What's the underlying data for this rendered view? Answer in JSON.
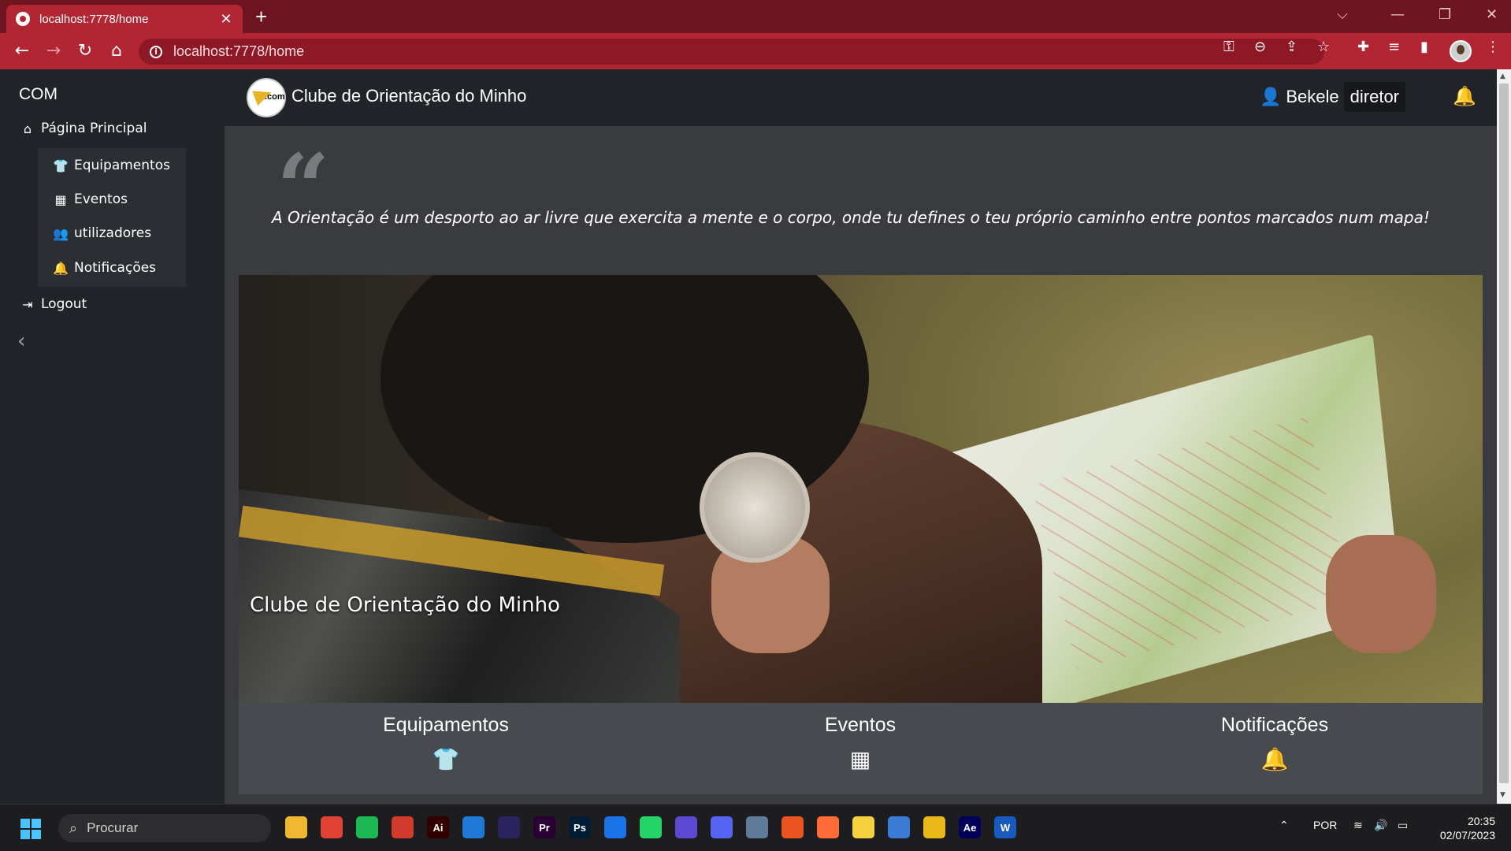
{
  "browser": {
    "tab_title": "localhost:7778/home",
    "tab_close": "✕",
    "new_tab": "+",
    "url": "localhost:7778/home",
    "controls": {
      "dropdown": "⌵",
      "minimize": "—",
      "restore": "❐",
      "close": "✕"
    }
  },
  "sidebar": {
    "brand": "COM",
    "home": {
      "label": "Página Principal",
      "icon": "home-icon"
    },
    "submenu": [
      {
        "label": "Equipamentos",
        "icon": "tshirt-icon"
      },
      {
        "label": "Eventos",
        "icon": "calendar-icon"
      },
      {
        "label": "utilizadores",
        "icon": "users-icon"
      },
      {
        "label": "Notificações",
        "icon": "bell-icon"
      }
    ],
    "logout": {
      "label": "Logout",
      "icon": "logout-icon"
    },
    "collapse_icon": "chevron-left-icon"
  },
  "header": {
    "logo_text": ".com",
    "site_title": "Clube de Orientação do Minho",
    "user_name": "Bekele",
    "user_role": "diretor"
  },
  "main": {
    "quote": "A Orientação é um desporto ao ar livre que exercita a mente e o corpo, onde tu defines o teu próprio caminho entre pontos marcados num mapa!",
    "hero_caption": "Clube de Orientação do Minho",
    "cards": [
      {
        "title": "Equipamentos",
        "icon": "tshirt-icon"
      },
      {
        "title": "Eventos",
        "icon": "calendar-icon"
      },
      {
        "title": "Notificações",
        "icon": "bell-icon"
      }
    ]
  },
  "taskbar": {
    "search_placeholder": "Procurar",
    "language": "POR",
    "time": "20:35",
    "date": "02/07/2023",
    "apps": [
      {
        "name": "file-explorer",
        "label": "",
        "color": "#f2b731"
      },
      {
        "name": "chrome",
        "label": "",
        "color": "#e04236"
      },
      {
        "name": "spotify",
        "label": "",
        "color": "#1db954"
      },
      {
        "name": "app-red-yellow",
        "label": "",
        "color": "#d23a2b"
      },
      {
        "name": "illustrator",
        "label": "Ai",
        "color": "#330000"
      },
      {
        "name": "vscode",
        "label": "",
        "color": "#1e7ad6"
      },
      {
        "name": "dark-app",
        "label": "",
        "color": "#2b2360"
      },
      {
        "name": "premiere",
        "label": "Pr",
        "color": "#2a0034"
      },
      {
        "name": "photoshop",
        "label": "Ps",
        "color": "#001d34"
      },
      {
        "name": "mail",
        "label": "",
        "color": "#1a73e8"
      },
      {
        "name": "whatsapp",
        "label": "",
        "color": "#25d366"
      },
      {
        "name": "moon-app",
        "label": "",
        "color": "#5b4ad1"
      },
      {
        "name": "discord",
        "label": "",
        "color": "#5865f2"
      },
      {
        "name": "photos-app",
        "label": "",
        "color": "#5e7b9a"
      },
      {
        "name": "ubuntu",
        "label": "",
        "color": "#e95420"
      },
      {
        "name": "postman",
        "label": "",
        "color": "#ff6c37"
      },
      {
        "name": "tips-app",
        "label": "",
        "color": "#f5d142"
      },
      {
        "name": "box-app",
        "label": "",
        "color": "#3a7bd5"
      },
      {
        "name": "yellow-app",
        "label": "",
        "color": "#e8b916"
      },
      {
        "name": "after-effects",
        "label": "Ae",
        "color": "#00005b"
      },
      {
        "name": "word",
        "label": "W",
        "color": "#185abd"
      }
    ]
  },
  "colors": {
    "chrome_dark": "#6e1520",
    "chrome_accent": "#b22634",
    "sidebar_bg": "#212529",
    "main_bg": "#393b3f"
  }
}
